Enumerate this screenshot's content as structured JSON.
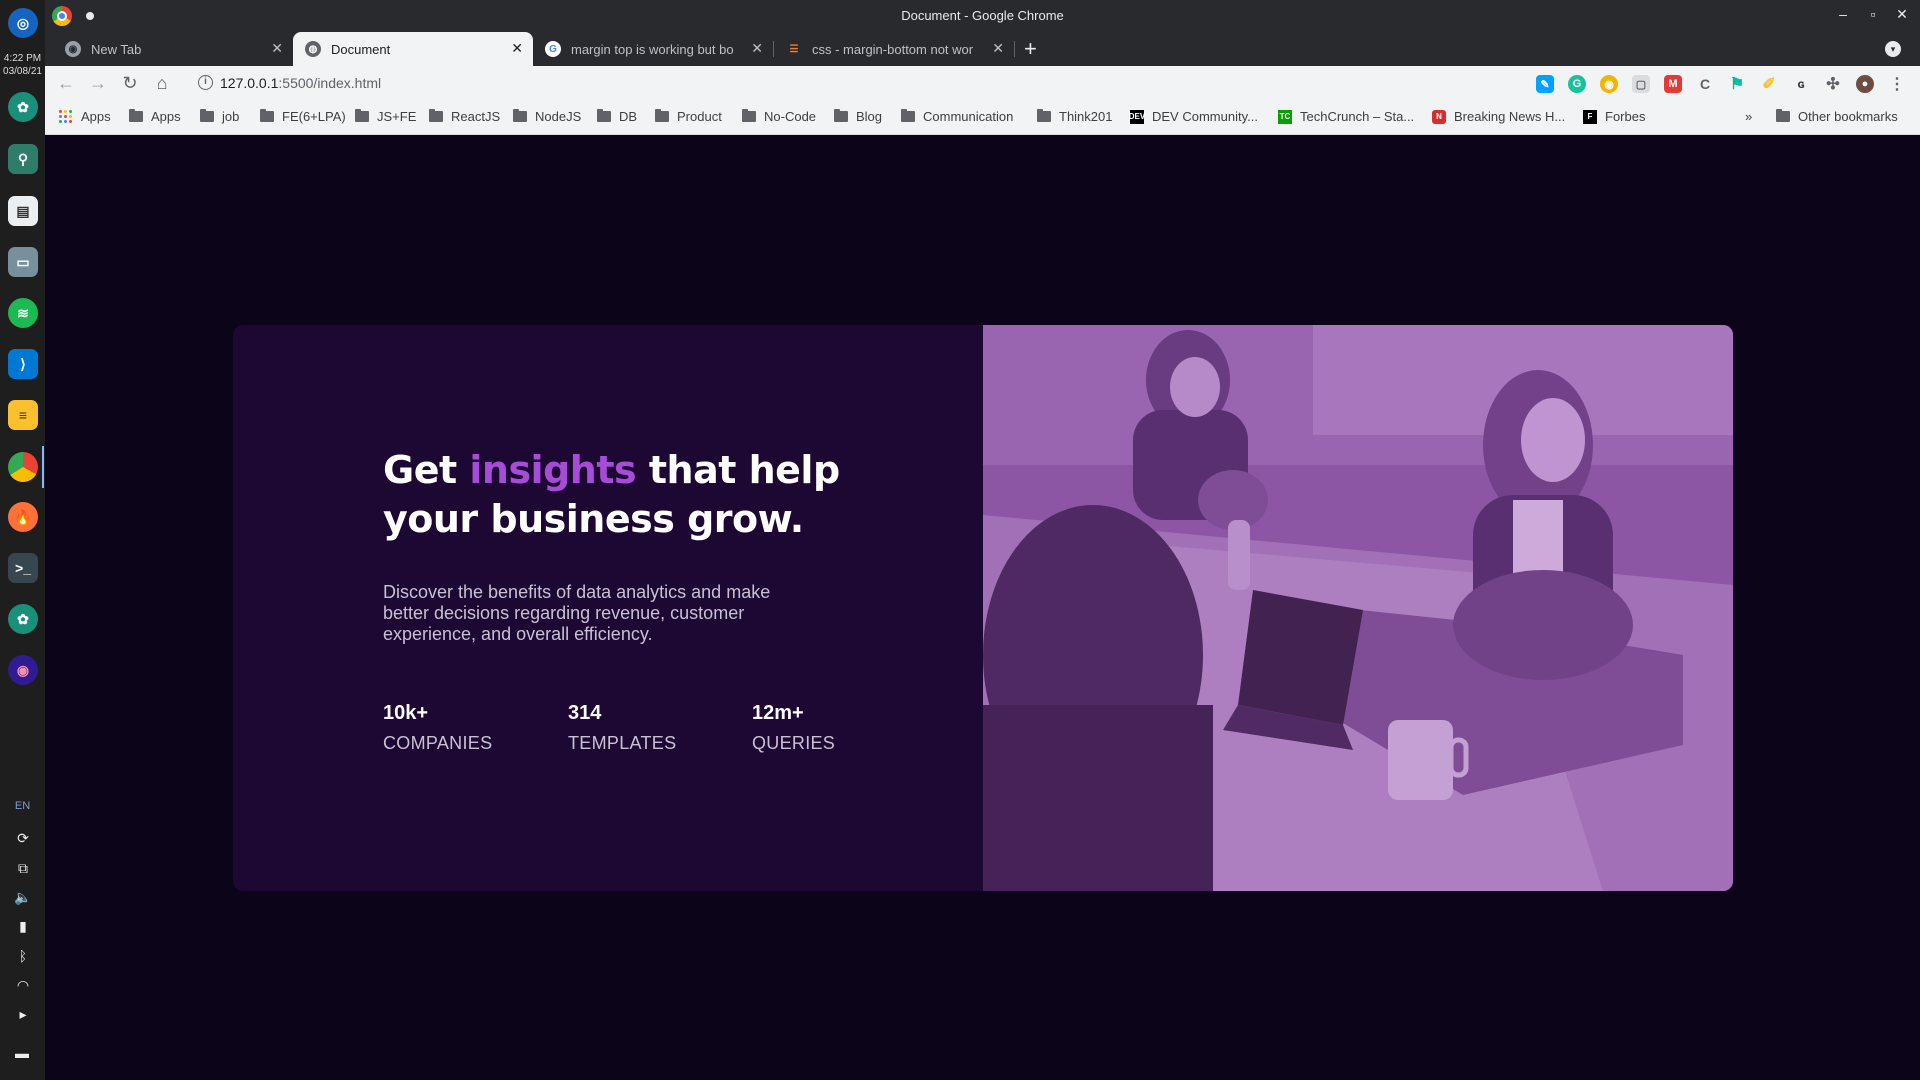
{
  "os": {
    "clock_time": "4:22 PM",
    "clock_date": "03/08/21",
    "lang": "EN"
  },
  "browser": {
    "window_title": "Document - Google Chrome",
    "tabs": [
      {
        "label": "New Tab",
        "active": false
      },
      {
        "label": "Document",
        "active": true
      },
      {
        "label": "margin top is working but bo",
        "active": false
      },
      {
        "label": "css - margin-bottom not wor",
        "active": false
      }
    ],
    "url_host": "127.0.0.1",
    "url_path": ":5500/index.html",
    "bookmarks": [
      {
        "label": "Apps",
        "icon": "apps-grid-icon"
      },
      {
        "label": "Apps",
        "icon": "folder-icon"
      },
      {
        "label": "job",
        "icon": "folder-icon"
      },
      {
        "label": "FE(6+LPA)",
        "icon": "folder-icon"
      },
      {
        "label": "JS+FE",
        "icon": "folder-icon"
      },
      {
        "label": "ReactJS",
        "icon": "folder-icon"
      },
      {
        "label": "NodeJS",
        "icon": "folder-icon"
      },
      {
        "label": "DB",
        "icon": "folder-icon"
      },
      {
        "label": "Product",
        "icon": "folder-icon"
      },
      {
        "label": "No-Code",
        "icon": "folder-icon"
      },
      {
        "label": "Blog",
        "icon": "folder-icon"
      },
      {
        "label": "Communication",
        "icon": "folder-icon"
      },
      {
        "label": "Think201",
        "icon": "folder-icon"
      },
      {
        "label": "DEV Community...",
        "icon": "dev-icon"
      },
      {
        "label": "TechCrunch – Sta...",
        "icon": "techcrunch-icon"
      },
      {
        "label": "Breaking News H...",
        "icon": "news-icon"
      },
      {
        "label": "Forbes",
        "icon": "forbes-icon"
      }
    ],
    "bookmarks_overflow": "»",
    "other_bookmarks": "Other bookmarks"
  },
  "page": {
    "headline_pre": "Get ",
    "headline_accent": "insights",
    "headline_post": " that help your business grow.",
    "description": "Discover the benefits of data analytics and make better decisions regarding revenue, customer experience, and overall efficiency.",
    "stats": [
      {
        "value": "10k+",
        "label": "COMPANIES"
      },
      {
        "value": "314",
        "label": "TEMPLATES"
      },
      {
        "value": "12m+",
        "label": "QUERIES"
      }
    ],
    "colors": {
      "background": "#0c0418",
      "card": "#1c0833",
      "accent": "#a64cd6",
      "image_overlay": "#8d56a5"
    }
  }
}
